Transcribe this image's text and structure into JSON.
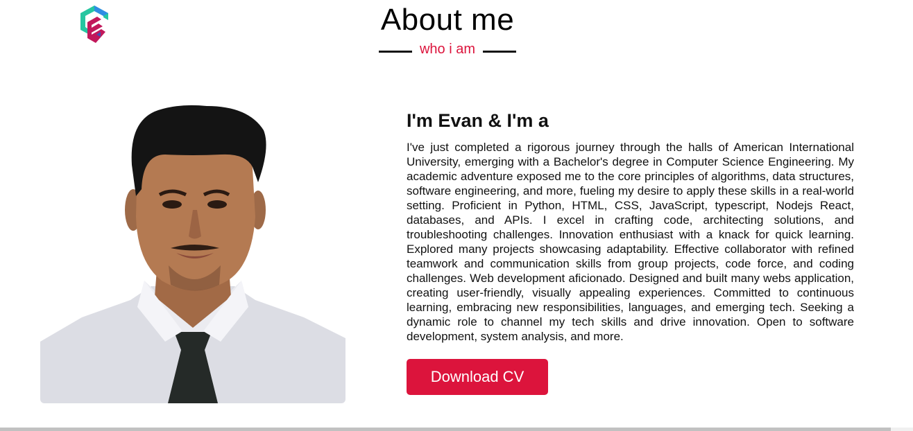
{
  "header": {
    "title": "About me",
    "subtitle": "who i am"
  },
  "logo": {
    "icon": "brand-logo-icon",
    "colors": [
      "#26c6a1",
      "#2f8de4",
      "#c2185b"
    ]
  },
  "profile": {
    "photo_icon": "profile-photo"
  },
  "about": {
    "heading": "I'm Evan & I'm a",
    "bio": "I've just completed a rigorous journey through the halls of American International University, emerging with a Bachelor's degree in Computer Science Engineering. My academic adventure exposed me to the core principles of algorithms, data structures, software engineering, and more, fueling my desire to apply these skills in a real-world setting. Proficient in Python, HTML, CSS, JavaScript, typescript, Nodejs React, databases, and APIs. I excel in crafting code, architecting solutions, and troubleshooting challenges. Innovation enthusiast with a knack for quick learning. Explored many projects showcasing adaptability. Effective collaborator with refined teamwork and communication skills from group projects, code force, and coding challenges. Web development aficionado. Designed and built many webs application, creating user-friendly, visually appealing experiences. Committed to continuous learning, embracing new responsibilities, languages, and emerging tech. Seeking a dynamic role to channel my tech skills and drive innovation. Open to software development, system analysis, and more.",
    "button_label": "Download CV"
  },
  "colors": {
    "accent": "#dc143c",
    "text": "#111111",
    "background": "#ffffff"
  }
}
